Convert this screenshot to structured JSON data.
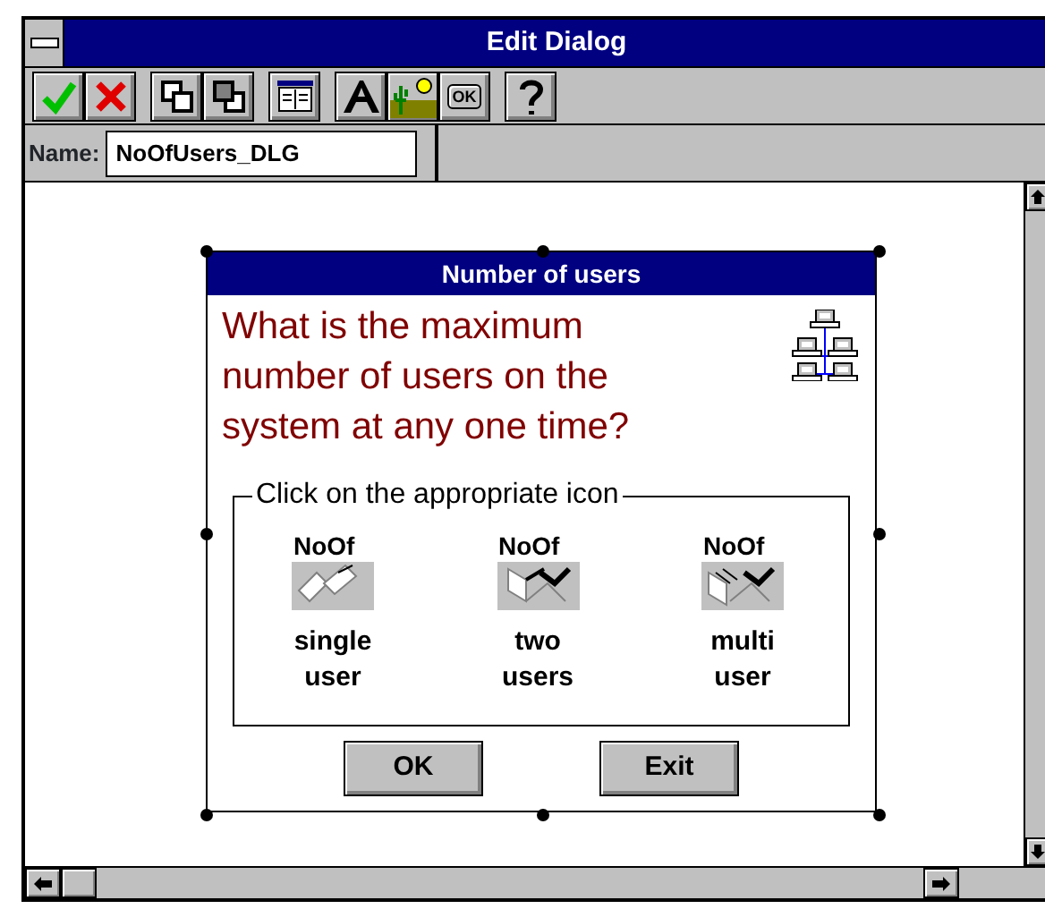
{
  "window": {
    "title": "Edit Dialog"
  },
  "toolbar": [
    {
      "kind": "accept"
    },
    {
      "kind": "cancel"
    },
    {
      "kind": "front"
    },
    {
      "kind": "back"
    },
    {
      "kind": "book"
    },
    {
      "kind": "text"
    },
    {
      "kind": "picture"
    },
    {
      "kind": "okbutton",
      "text": "OK"
    },
    {
      "kind": "help"
    }
  ],
  "name_field": {
    "label": "Name:",
    "value": "NoOfUsers_DLG"
  },
  "dialog": {
    "title": "Number of users",
    "selected": true,
    "question": "What is the maximum number of users on the system at any one time?",
    "group_label": "Click on the appropriate icon",
    "options": [
      {
        "icon_text": "NoOf",
        "kind": "single",
        "label": "single\nuser"
      },
      {
        "icon_text": "NoOf",
        "kind": "two",
        "label": "two\nusers"
      },
      {
        "icon_text": "NoOf",
        "kind": "multi",
        "label": "multi\nuser"
      }
    ],
    "buttons": [
      "OK",
      "Exit"
    ]
  }
}
